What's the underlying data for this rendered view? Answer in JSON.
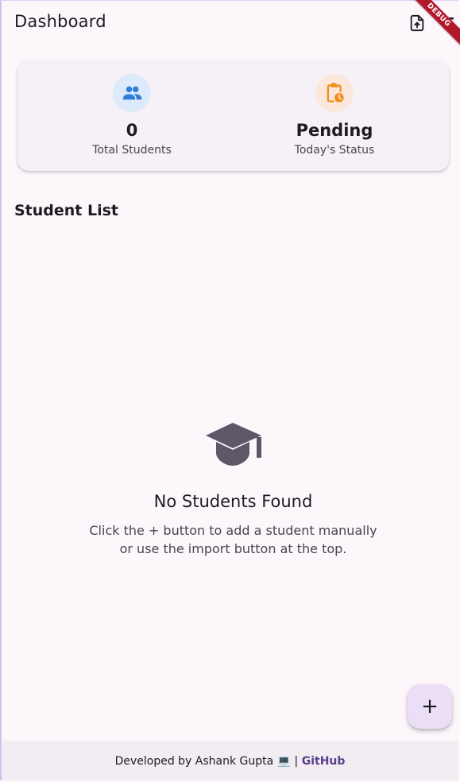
{
  "appbar": {
    "title": "Dashboard",
    "debug_label": "DEBUG"
  },
  "summary": {
    "students": {
      "value": "0",
      "label": "Total Students",
      "icon": "people-icon",
      "icon_bg": "#dceafb",
      "icon_color": "#2f7fd8"
    },
    "status": {
      "value": "Pending",
      "label": "Today's Status",
      "icon": "clipboard-clock-icon",
      "icon_bg": "#fbe7dc",
      "icon_color": "#f28f1b"
    }
  },
  "student_list": {
    "title": "Student List",
    "empty_title": "No Students Found",
    "empty_line1": "Click the + button to add a student manually",
    "empty_line2": "or use the import button at the top."
  },
  "fab": {
    "label": "+"
  },
  "footer": {
    "text": "Developed by Ashank Gupta 💻 | ",
    "link": "GitHub"
  },
  "colors": {
    "background": "#fdf7fc",
    "card": "#f6f1f7",
    "fab": "#ebdff8",
    "empty_icon": "#5f5668",
    "link": "#5a3f8c",
    "debug": "#b3182a"
  }
}
